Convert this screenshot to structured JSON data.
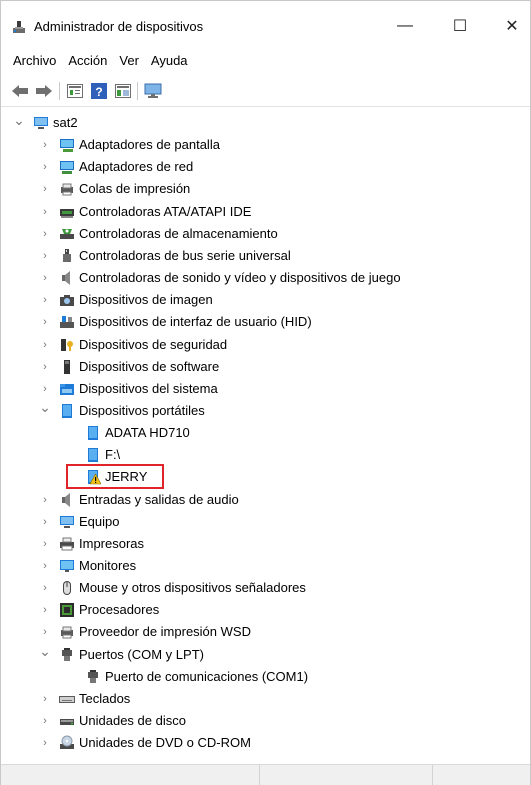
{
  "window": {
    "title": "Administrador de dispositivos",
    "caption": {
      "minimize": "—",
      "maximize": "☐",
      "close": "✕"
    }
  },
  "menu": [
    "Archivo",
    "Acción",
    "Ver",
    "Ayuda"
  ],
  "toolbar": [
    "back-icon",
    "forward-icon",
    "properties-icon",
    "help-icon",
    "show-hide-console-tree-icon",
    "monitor-icon"
  ],
  "tree": {
    "root": "sat2",
    "nodes": [
      {
        "label": "Adaptadores de pantalla",
        "icon": "display-adapter-icon"
      },
      {
        "label": "Adaptadores de red",
        "icon": "network-adapter-icon"
      },
      {
        "label": "Colas de impresión",
        "icon": "print-queue-icon"
      },
      {
        "label": "Controladoras ATA/ATAPI IDE",
        "icon": "ide-controller-icon"
      },
      {
        "label": "Controladoras de almacenamiento",
        "icon": "storage-controller-icon"
      },
      {
        "label": "Controladoras de bus serie universal",
        "icon": "usb-icon"
      },
      {
        "label": "Controladoras de sonido y vídeo y dispositivos de juego",
        "icon": "speaker-icon"
      },
      {
        "label": "Dispositivos de imagen",
        "icon": "camera-icon"
      },
      {
        "label": "Dispositivos de interfaz de usuario (HID)",
        "icon": "hid-icon"
      },
      {
        "label": "Dispositivos de seguridad",
        "icon": "security-icon"
      },
      {
        "label": "Dispositivos de software",
        "icon": "software-device-icon"
      },
      {
        "label": "Dispositivos del sistema",
        "icon": "system-folder-icon"
      },
      {
        "label": "Dispositivos portátiles",
        "icon": "portable-device-icon",
        "expanded": true,
        "children": [
          {
            "label": "ADATA HD710",
            "icon": "portable-device-icon"
          },
          {
            "label": "F:\\",
            "icon": "portable-device-icon"
          },
          {
            "label": "JERRY",
            "icon": "warning-icon",
            "highlighted": true
          }
        ]
      },
      {
        "label": "Entradas y salidas de audio",
        "icon": "speaker-icon"
      },
      {
        "label": "Equipo",
        "icon": "computer-icon"
      },
      {
        "label": "Impresoras",
        "icon": "printer-icon"
      },
      {
        "label": "Monitores",
        "icon": "monitor-icon"
      },
      {
        "label": "Mouse y otros dispositivos señaladores",
        "icon": "mouse-icon"
      },
      {
        "label": "Procesadores",
        "icon": "processor-icon"
      },
      {
        "label": "Proveedor de impresión WSD",
        "icon": "print-queue-icon"
      },
      {
        "label": "Puertos (COM y LPT)",
        "icon": "port-icon",
        "expanded": true,
        "children": [
          {
            "label": "Puerto de comunicaciones (COM1)",
            "icon": "port-icon"
          }
        ]
      },
      {
        "label": "Teclados",
        "icon": "keyboard-icon"
      },
      {
        "label": "Unidades de disco",
        "icon": "disk-drive-icon"
      },
      {
        "label": "Unidades de DVD o CD-ROM",
        "icon": "dvd-drive-icon"
      }
    ]
  },
  "colors": {
    "highlight": "#e0242a",
    "accent": "#1e7bd8"
  }
}
